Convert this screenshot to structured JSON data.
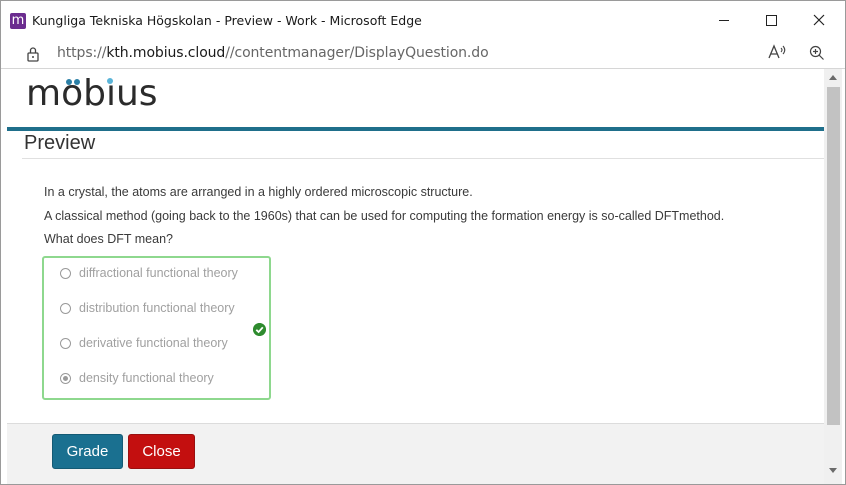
{
  "window": {
    "title": "Kungliga Tekniska Högskolan - Preview - Work - Microsoft Edge",
    "app_icon_letter": "m"
  },
  "address": {
    "url_prefix": "https://",
    "url_host": "kth.mobius.cloud",
    "url_path": "//contentmanager/DisplayQuestion.do",
    "read_aloud": "Aͅ"
  },
  "page": {
    "logo": "möbius",
    "logo_colors": {
      "text": "#2b2b2b",
      "dots": "#2a7fa6",
      "accent_bar": "#1f6f8b"
    },
    "heading": "Preview"
  },
  "question": {
    "line1": "In a crystal, the atoms are arranged in a highly ordered microscopic structure.",
    "line2": "A classical method (going back to the 1960s) that can be used for computing the formation energy is so-called  DFTmethod.",
    "line3": "What does DFT mean?",
    "options": [
      {
        "label": "diffractional functional theory",
        "selected": false
      },
      {
        "label": "distribution functional theory",
        "selected": false
      },
      {
        "label": "derivative functional theory",
        "selected": false
      },
      {
        "label": "density functional theory",
        "selected": true
      }
    ],
    "status": "correct",
    "status_color": "#2e8b2e",
    "answer_border_color": "#8ed88e"
  },
  "footer": {
    "grade_label": "Grade",
    "close_label": "Close",
    "grade_color": "#1a7090",
    "close_color": "#c30f0f"
  }
}
